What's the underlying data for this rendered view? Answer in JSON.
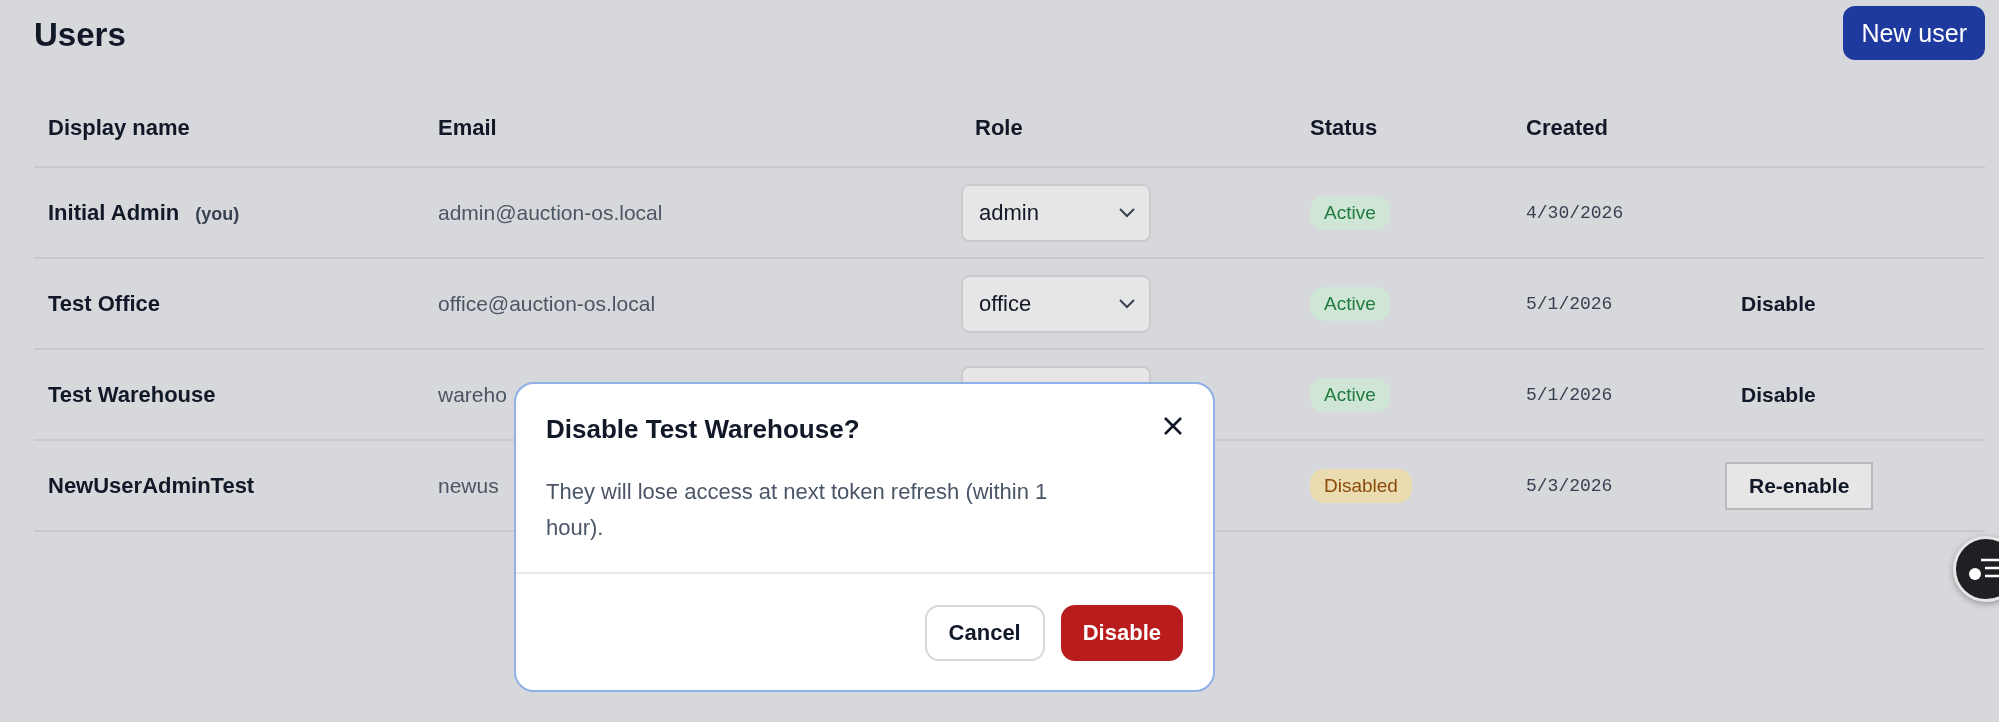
{
  "header": {
    "title": "Users",
    "new_button": "New user"
  },
  "table": {
    "columns": [
      "Display name",
      "Email",
      "Role",
      "Status",
      "Created"
    ],
    "rows": [
      {
        "name": "Initial Admin",
        "you_tag": "(you)",
        "email": "admin@auction-os.local",
        "role_select": true,
        "role": "admin",
        "status": {
          "label": "Active",
          "kind": "active"
        },
        "created": "4/30/2026"
      },
      {
        "name": "Test Office",
        "email": "office@auction-os.local",
        "role_select": true,
        "role": "office",
        "status": {
          "label": "Active",
          "kind": "active"
        },
        "created": "5/1/2026",
        "action": {
          "label": "Disable",
          "kind": "plain"
        }
      },
      {
        "name": "Test Warehouse",
        "email": "wareho",
        "role_select": true,
        "status": {
          "label": "Active",
          "kind": "active"
        },
        "created": "5/1/2026",
        "action": {
          "label": "Disable",
          "kind": "plain"
        }
      },
      {
        "name": "NewUserAdminTest",
        "email": "newus",
        "role_select": false,
        "status": {
          "label": "Disabled",
          "kind": "disabled"
        },
        "created": "5/3/2026",
        "action": {
          "label": "Re-enable",
          "kind": "outlined"
        }
      }
    ]
  },
  "dialog": {
    "title": "Disable Test Warehouse?",
    "message": "They will lose access at next token refresh (within 1 hour).",
    "buttons": [
      {
        "label": "Cancel",
        "kind": "secondary"
      },
      {
        "label": "Disable",
        "kind": "danger"
      }
    ]
  }
}
